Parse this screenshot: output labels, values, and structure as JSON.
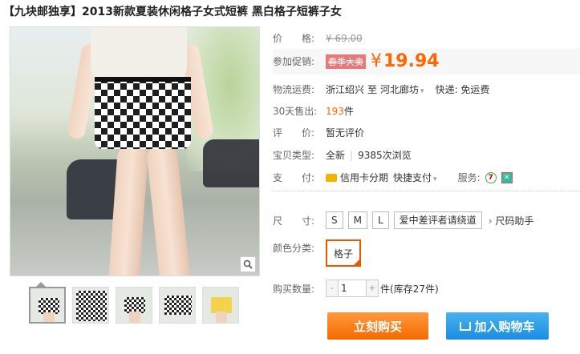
{
  "product": {
    "title": "【九块邮独享】2013新款夏装休闲格子女式短裤 黑白格子短裤子女"
  },
  "price": {
    "label": "价　　格:",
    "original": "¥ 69.00",
    "promo_label": "参加促销:",
    "promo_tag": "春季大卖",
    "currency": "¥",
    "sale": "19.94"
  },
  "shipping": {
    "label": "物流运费:",
    "from": "浙江绍兴",
    "to_prefix": "至",
    "to": "河北廊坊",
    "express": "快递: 免运费"
  },
  "sales": {
    "label": "30天售出:",
    "count": "193",
    "unit": "件"
  },
  "review": {
    "label": "评　　价:",
    "value": "暂无评价"
  },
  "item_type": {
    "label": "宝贝类型:",
    "condition": "全新",
    "views": "9385次浏览"
  },
  "payment": {
    "label": "支　　付:",
    "credit": "信用卡分期",
    "quick": "快捷支付",
    "service_label": "服务:",
    "service_icon_text": "7"
  },
  "size": {
    "label": "尺　　寸:",
    "options": [
      "S",
      "M",
      "L",
      "爱中差评者请绕道"
    ],
    "helper": "尺码助手"
  },
  "color": {
    "label": "颜色分类:",
    "selected": "格子"
  },
  "quantity": {
    "label": "购买数量:",
    "minus": "-",
    "value": "1",
    "plus": "+",
    "unit": "件",
    "stock": "(库存27件)"
  },
  "actions": {
    "buy": "立刻购买",
    "cart": "加入购物车"
  },
  "icons": {
    "zoom": "magnifier-icon",
    "cart": "cart-icon",
    "credit_card": "credit-card-icon"
  },
  "colors": {
    "accent": "#ff6600",
    "buy_button": "#f36a00",
    "cart_button": "#1a8de0"
  }
}
